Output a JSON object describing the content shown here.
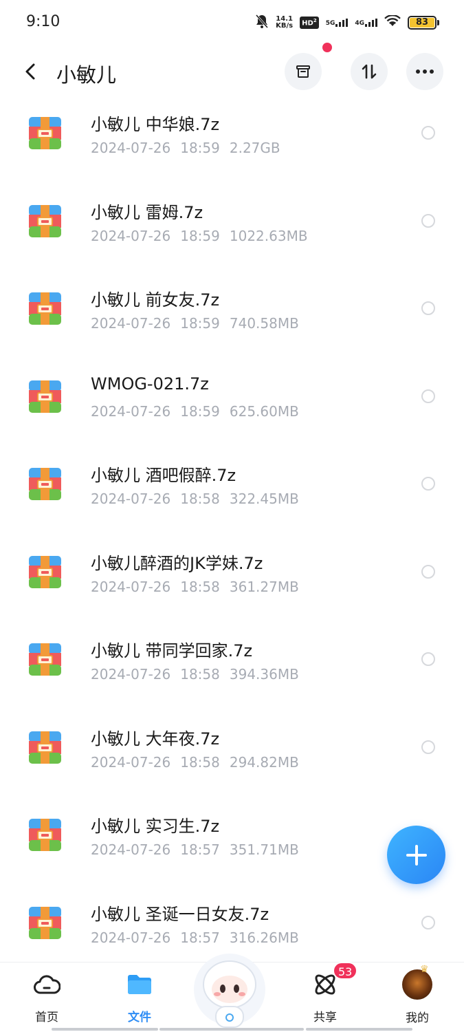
{
  "status_bar": {
    "time": "9:10",
    "speed_value": "14.1",
    "speed_unit": "KB/s",
    "hd": "HD",
    "hd_sub": "2",
    "net_5g": "5G",
    "net_4g": "4G",
    "battery": "83",
    "icons": [
      "mute-bell-icon",
      "signal-icon",
      "wifi-icon",
      "battery-icon"
    ]
  },
  "header": {
    "title": "小敏儿",
    "buttons": [
      "box-icon",
      "sort-icon",
      "more-icon"
    ]
  },
  "files": [
    {
      "name": "小敏儿 中华娘.7z",
      "date": "2024-07-26",
      "time": "18:59",
      "size": "2.27GB"
    },
    {
      "name": "小敏儿 雷姆.7z",
      "date": "2024-07-26",
      "time": "18:59",
      "size": "1022.63MB"
    },
    {
      "name": "小敏儿 前女友.7z",
      "date": "2024-07-26",
      "time": "18:59",
      "size": "740.58MB"
    },
    {
      "name": "WMOG-021.7z",
      "date": "2024-07-26",
      "time": "18:59",
      "size": "625.60MB"
    },
    {
      "name": "小敏儿 酒吧假醉.7z",
      "date": "2024-07-26",
      "time": "18:58",
      "size": "322.45MB"
    },
    {
      "name": "小敏儿醉酒的JK学妹.7z",
      "date": "2024-07-26",
      "time": "18:58",
      "size": "361.27MB"
    },
    {
      "name": "小敏儿 带同学回家.7z",
      "date": "2024-07-26",
      "time": "18:58",
      "size": "394.36MB"
    },
    {
      "name": "小敏儿 大年夜.7z",
      "date": "2024-07-26",
      "time": "18:58",
      "size": "294.82MB"
    },
    {
      "name": "小敏儿 实习生.7z",
      "date": "2024-07-26",
      "time": "18:57",
      "size": "351.71MB"
    },
    {
      "name": "小敏儿 圣诞一日女友.7z",
      "date": "2024-07-26",
      "time": "18:57",
      "size": "316.26MB"
    }
  ],
  "bottom_nav": {
    "home": "首页",
    "files": "文件",
    "share": "共享",
    "mine": "我的",
    "share_badge": "53"
  },
  "colors": {
    "accent": "#2e8df5",
    "badge": "#f0315a",
    "meta_text": "#a7abb3",
    "archive_red": "#ef5b5b",
    "archive_blue": "#4aa8f0",
    "archive_green": "#6cc04a",
    "archive_orange": "#f29a38"
  }
}
